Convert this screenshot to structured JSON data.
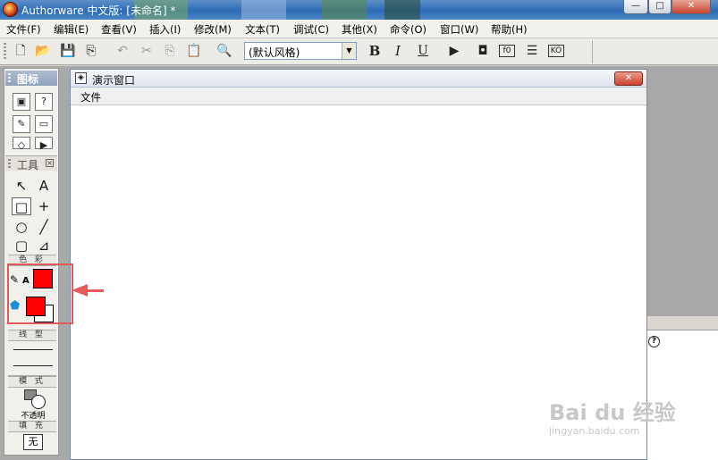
{
  "window": {
    "title": "Authorware 中文版: [未命名] *",
    "controls": {
      "minimize": "—",
      "maximize": "□",
      "close": "✕"
    }
  },
  "menubar": {
    "items": [
      "文件(F)",
      "编辑(E)",
      "查看(V)",
      "插入(I)",
      "修改(M)",
      "文本(T)",
      "调试(C)",
      "其他(X)",
      "命令(O)",
      "窗口(W)",
      "帮助(H)"
    ]
  },
  "toolbar": {
    "style_select_value": "(默认风格)",
    "style_select_arrow": "▼",
    "buttons": {
      "new": "🗋",
      "open": "📂",
      "save_all": "💾",
      "import": "⎘",
      "undo": "↶",
      "cut": "✂",
      "copy": "⎘",
      "paste": "📋",
      "find": "🔍",
      "bold": "B",
      "italic": "I",
      "underline": "U",
      "run": "▶",
      "control_panel": "◘",
      "functions": "f0",
      "variables": "☰",
      "knowledge": "KO"
    }
  },
  "palette": {
    "icons_header": "图标",
    "tools_header": "工具",
    "tools_close": "×",
    "color_label": "色 彩",
    "line_label": "线 型",
    "mode_label": "模 式",
    "mode_value": "不透明",
    "fill_label": "填 充",
    "fill_value": "无",
    "icon_buttons": {
      "display": "▣",
      "wait": "?",
      "calc": "✎",
      "interact": "▭",
      "erase": "◇",
      "video": "▶"
    },
    "tools": {
      "pointer": "↖",
      "text": "A",
      "rect": "□",
      "cross": "+",
      "ellipse": "○",
      "line": "╱",
      "rounded": "▢",
      "polygon": "⊿"
    },
    "colors": {
      "line_color": "#ff0000",
      "fill_fg": "#ff0000",
      "fill_bg": "#ffffff",
      "pen_letter": "A"
    }
  },
  "presentation_window": {
    "title": "演示窗口",
    "close": "✕",
    "menu": [
      "文件"
    ]
  },
  "right_panel": {
    "help": "?"
  },
  "watermark": {
    "main": "Bai du 经验",
    "sub": "jingyan.baidu.com"
  },
  "colors": {
    "titlebar": "#2d6bb5",
    "highlight": "#e05a5a",
    "swatch": "#ff0000"
  }
}
